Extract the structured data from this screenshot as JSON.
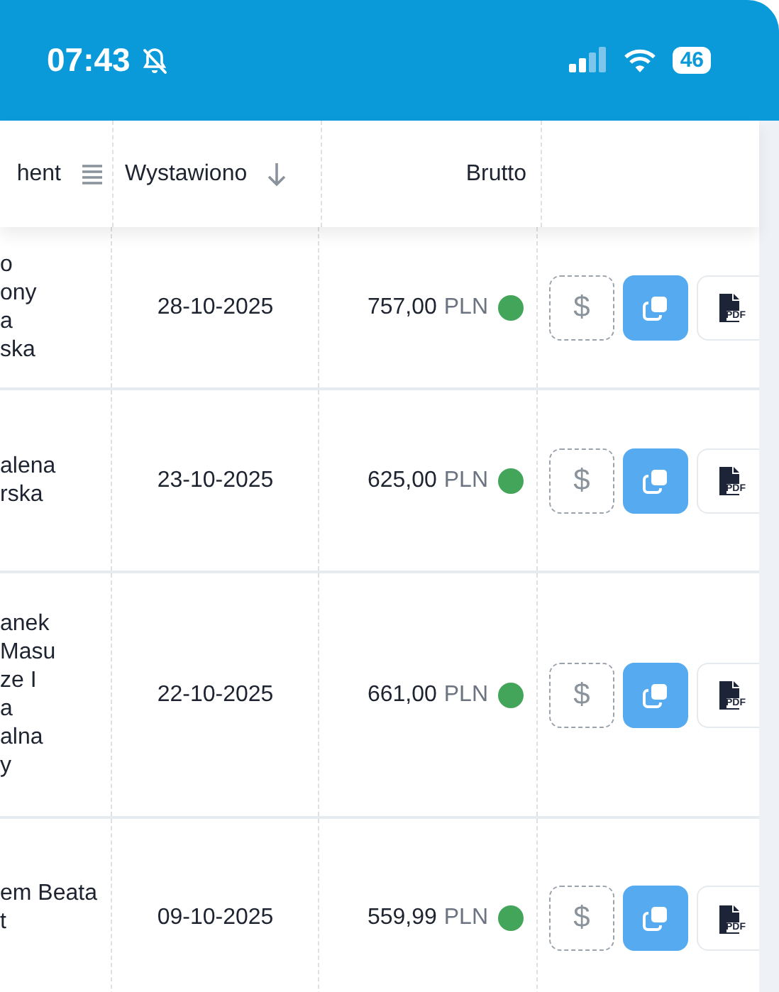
{
  "status_bar": {
    "time": "07:43",
    "silent": true,
    "battery": "46"
  },
  "table": {
    "columns": [
      {
        "label": "hent",
        "kind": "filter"
      },
      {
        "label": "Wystawiono",
        "kind": "sorted"
      },
      {
        "label": "Brutto",
        "kind": "plain"
      }
    ],
    "rows": [
      {
        "client": "o\nony\na\nska",
        "date": "28-10-2025",
        "amount": "757,00",
        "currency": "PLN",
        "color": "#43a55a",
        "pay": "$",
        "pdf": "PDF"
      },
      {
        "client": "alena\nrska",
        "date": "23-10-2025",
        "amount": "625,00",
        "currency": "PLN",
        "color": "#43a55a",
        "pay": "$",
        "pdf": "PDF"
      },
      {
        "client": "anek\nMasu\nze I\na\nalna\ny",
        "date": "22-10-2025",
        "amount": "661,00",
        "currency": "PLN",
        "color": "#43a55a",
        "pay": "$",
        "pdf": "PDF"
      },
      {
        "client": "em Beata\nt",
        "date": "09-10-2025",
        "amount": "559,99",
        "currency": "PLN",
        "color": "#43a55a",
        "pay": "$",
        "pdf": "PDF"
      }
    ]
  }
}
